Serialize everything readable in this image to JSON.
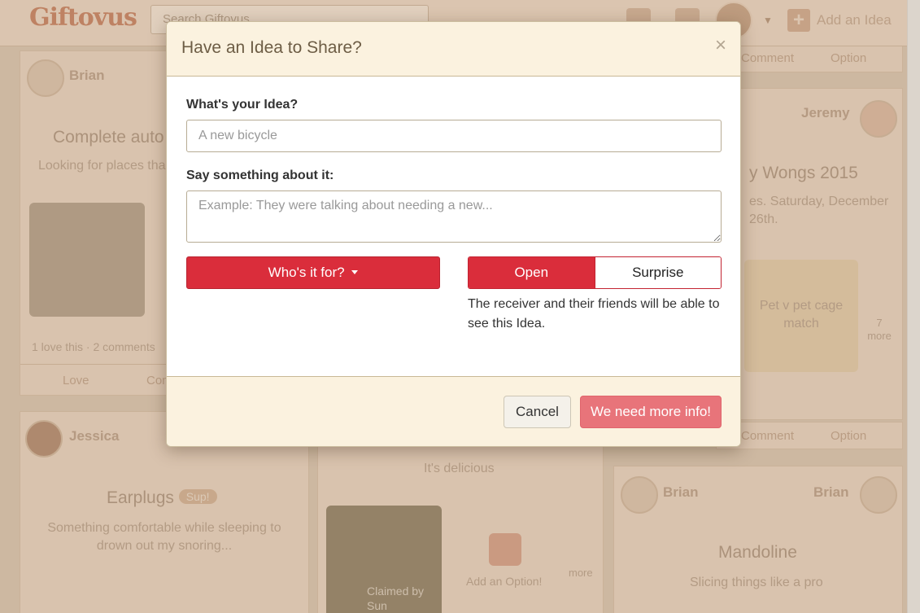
{
  "navbar": {
    "logo": "Giftovus",
    "search_placeholder": "Search Giftovus...",
    "add_idea_label": "Add an Idea"
  },
  "background": {
    "card1": {
      "name": "Brian",
      "title": "Complete auto",
      "text": "Looking for places tha",
      "stats": "1 love this · 2 comments",
      "love": "Love",
      "comment": "Comment"
    },
    "card2": {
      "to_name": "Jeremy",
      "title": "y Wongs 2015",
      "text": "es. Saturday, December 26th.",
      "option_title": "Pet v pet cage match",
      "more": "7 more"
    },
    "card3": {
      "name": "Jessica",
      "title": "Earplugs",
      "badge": "Sup!",
      "text": "Something comfortable while sleeping to drown out my snoring..."
    },
    "card4": {
      "text": "It's delicious",
      "claimed": "Claimed by Sun",
      "add_option": "Add an Option!",
      "more": "more"
    },
    "card5": {
      "from_name": "Brian",
      "to_name": "Brian",
      "title": "Mandoline",
      "text": "Slicing things like a pro"
    },
    "top_bar": {
      "comment": "Comment",
      "option": "Option"
    },
    "mid_bar": {
      "comment": "Comment",
      "option": "Option"
    }
  },
  "modal": {
    "title": "Have an Idea to Share?",
    "close": "×",
    "idea_label": "What's your Idea?",
    "idea_placeholder": "A new bicycle",
    "about_label": "Say something about it:",
    "about_placeholder": "Example: They were talking about needing a new...",
    "who_button": "Who's it for?",
    "visibility": {
      "open": "Open",
      "surprise": "Surprise",
      "selected": "Open"
    },
    "help_text": "The receiver and their friends will be able to see this Idea.",
    "cancel": "Cancel",
    "submit": "We need more info!"
  },
  "colors": {
    "accent_red": "#da2d3b",
    "submit_pink": "#e8747a",
    "header_cream": "#fbf2df"
  }
}
